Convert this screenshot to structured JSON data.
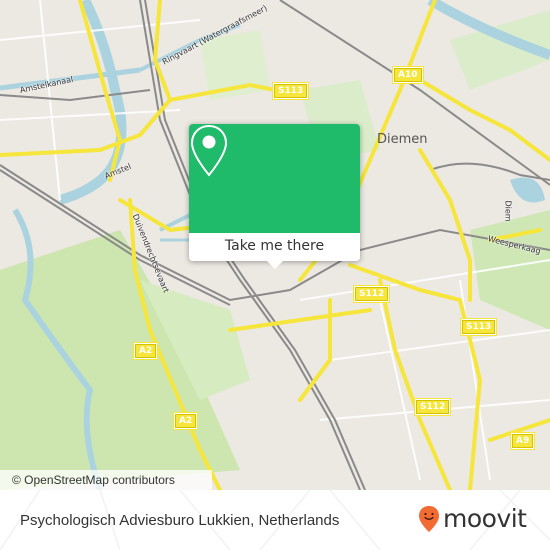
{
  "map": {
    "attribution": "© OpenStreetMap contributors",
    "places": [
      {
        "name": "Diemen"
      }
    ],
    "streets": [
      {
        "name": "Amstelkanaal"
      },
      {
        "name": "Ringvaart (Watergraafsmeer)"
      },
      {
        "name": "Amstel"
      },
      {
        "name": "Duivendrechtsevaart"
      },
      {
        "name": "Diem"
      },
      {
        "name": "Weesperkaag"
      }
    ],
    "road_shields": [
      {
        "label": "S113"
      },
      {
        "label": "A10"
      },
      {
        "label": "S112"
      },
      {
        "label": "S113"
      },
      {
        "label": "S112"
      },
      {
        "label": "A2"
      },
      {
        "label": "A2"
      },
      {
        "label": "A9"
      }
    ],
    "colors": {
      "land": "#ece8e2",
      "water": "#aad3df",
      "park": "#cde6b0",
      "road_major": "#f6e53a",
      "rail": "#888888"
    }
  },
  "popup": {
    "icon": "map-pin-icon",
    "action_label": "Take me there",
    "color": "#1fba6a"
  },
  "footer": {
    "title": "Psychologisch Adviesburo Lukkien, Netherlands",
    "logo_text": "moovit",
    "logo_color": "#f26b32"
  }
}
